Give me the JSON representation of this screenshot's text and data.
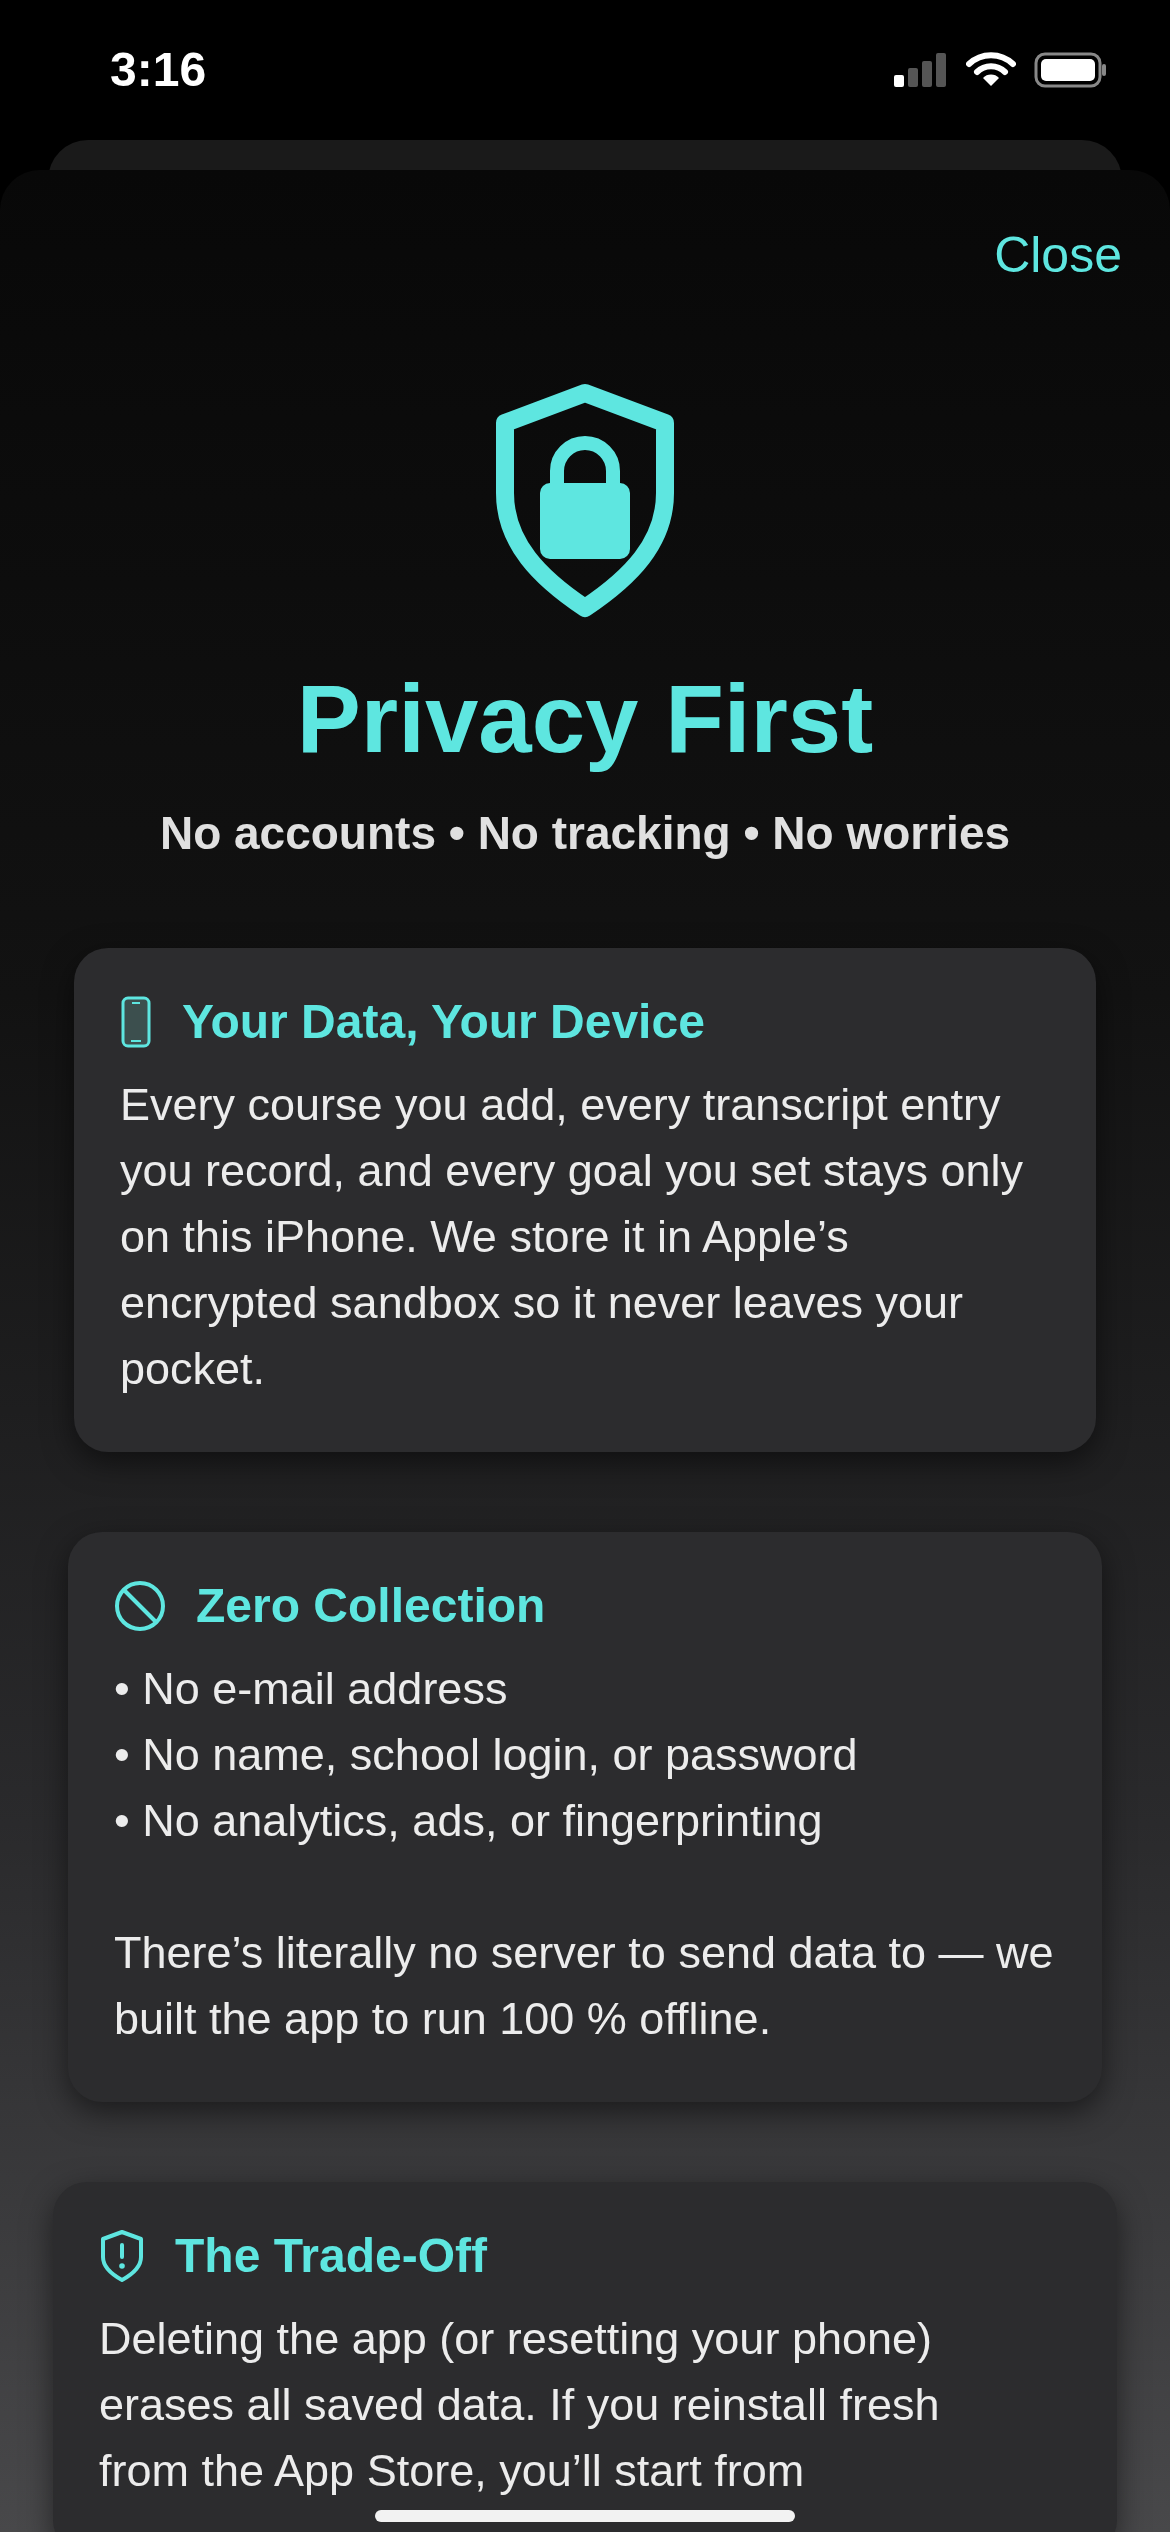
{
  "status_bar": {
    "time": "3:16"
  },
  "sheet": {
    "close": "Close",
    "title": "Privacy First",
    "subtitle": "No accounts • No tracking • No worries"
  },
  "cards": [
    {
      "kind": "paragraph",
      "title": "Your Data, Your Device",
      "body": "Every course you add, every transcript entry you record, and every goal you set stays only on this iPhone. We store it in Apple’s encrypted sandbox so it never leaves your pocket."
    },
    {
      "kind": "bullets",
      "title": "Zero Collection",
      "bullets": [
        "• No e-mail address",
        "• No name, school login, or password",
        "• No analytics, ads, or fingerprinting"
      ],
      "body": "There’s literally no server to send data to — we built the app to run 100 % offline."
    },
    {
      "kind": "lines",
      "title": "The Trade-Off",
      "lines": [
        "Deleting the app (or resetting your phone)",
        "erases all saved data. If you reinstall fresh",
        "from the App Store, you’ll start from"
      ]
    }
  ]
}
